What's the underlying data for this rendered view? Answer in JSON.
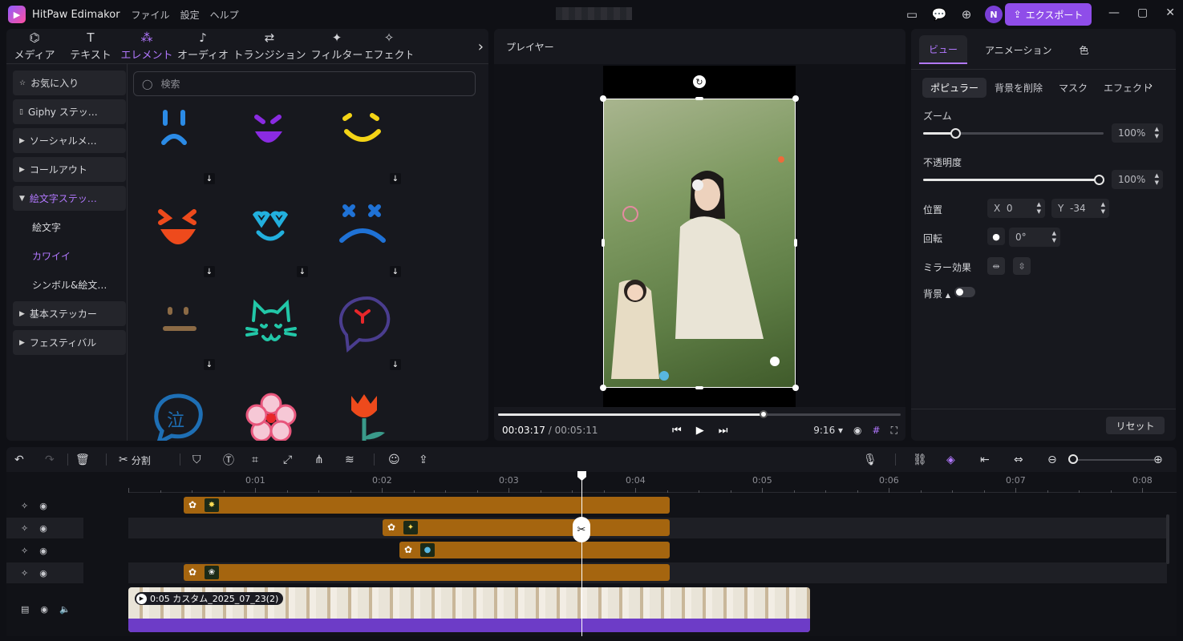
{
  "app": {
    "title": "HitPaw Edimakor",
    "menu": [
      "ファイル",
      "設定",
      "ヘルプ"
    ],
    "export_label": "エクスポート",
    "avatar_letter": "N"
  },
  "categories": [
    {
      "label": "メディア",
      "icon": "media-icon"
    },
    {
      "label": "テキスト",
      "icon": "text-icon"
    },
    {
      "label": "エレメント",
      "icon": "element-icon",
      "active": true
    },
    {
      "label": "オーディオ",
      "icon": "audio-icon"
    },
    {
      "label": "トランジション",
      "icon": "transition-icon"
    },
    {
      "label": "フィルター",
      "icon": "filter-icon"
    },
    {
      "label": "エフェクト",
      "icon": "effect-icon"
    }
  ],
  "sidebar": {
    "items": [
      {
        "label": "お気に入り",
        "icon": "star"
      },
      {
        "label": "Giphy ステッ…",
        "icon": "giphy"
      },
      {
        "label": "ソーシャルメ…"
      },
      {
        "label": "コールアウト"
      },
      {
        "label": "絵文字ステッ…"
      },
      {
        "label": "絵文字"
      },
      {
        "label": "カワイイ"
      },
      {
        "label": "シンボル&絵文…"
      },
      {
        "label": "基本ステッカー"
      },
      {
        "label": "フェスティバル"
      }
    ]
  },
  "search": {
    "placeholder": "検索"
  },
  "stickers": [
    "sad-face",
    "smile-face",
    "yellow-smile",
    "grin-face",
    "heart-eyes-face",
    "dizzy-face",
    "neutral-face",
    "cat-face",
    "angry-bubble",
    "cry-bubble",
    "flower",
    "tulip"
  ],
  "player": {
    "title": "プレイヤー",
    "current_time": "00:03:17",
    "separator": "/",
    "total_time": "00:05:11",
    "ratio": "9:16",
    "progress": 0.66
  },
  "props": {
    "tabs": [
      "ビュー",
      "アニメーション",
      "色"
    ],
    "subtabs": [
      "ポピュラー",
      "背景を削除",
      "マスク",
      "エフェクト"
    ],
    "zoom_label": "ズーム",
    "zoom_value": "100%",
    "zoom_level": 0.0,
    "opacity_label": "不透明度",
    "opacity_value": "100%",
    "opacity_level": 1.0,
    "position_label": "位置",
    "x_label": "X",
    "x_value": "0",
    "y_label": "Y",
    "y_value": "-34",
    "rotate_label": "回転",
    "rotate_value": "0°",
    "mirror_label": "ミラー効果",
    "bg_label": "背景",
    "reset_label": "リセット"
  },
  "toolbar": {
    "split_label": "分割"
  },
  "timeline": {
    "ticks": [
      "0:01",
      "0:02",
      "0:03",
      "0:04",
      "0:05",
      "0:06",
      "0:07",
      "0:08"
    ],
    "video_label": "0:05 カスタム_2025_07_23(2)",
    "colors": {
      "accent": "#8f4de9",
      "clip": "#a5650f",
      "video_bar": "#6d3cc7"
    }
  }
}
